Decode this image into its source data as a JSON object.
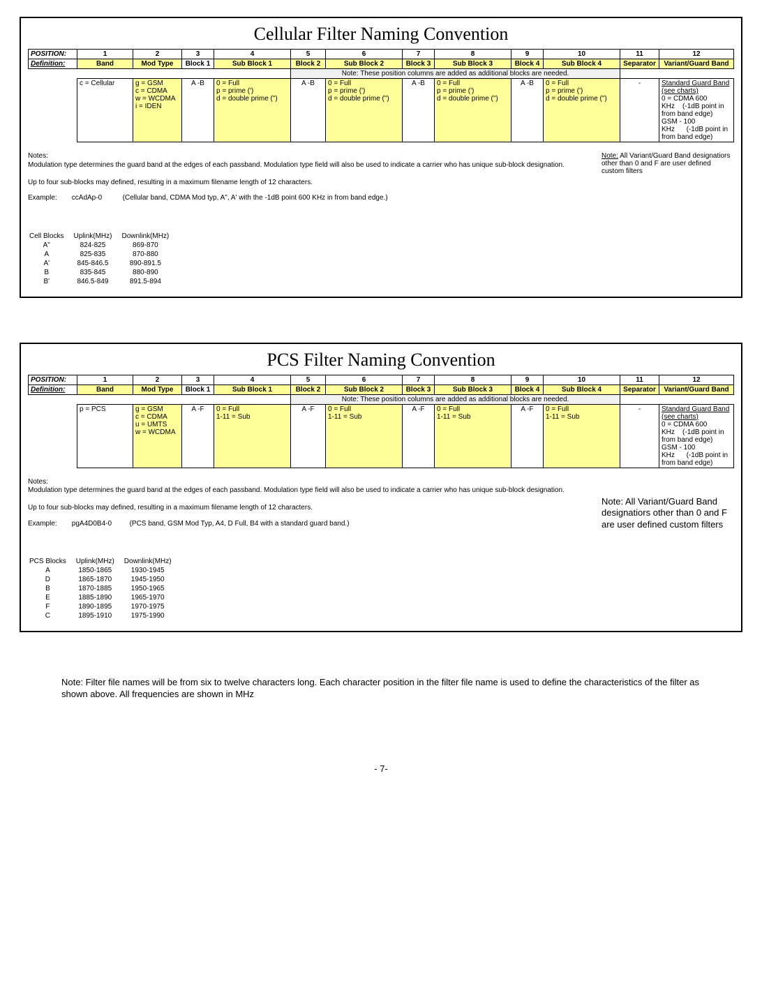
{
  "cellular": {
    "title": "Cellular Filter Naming Convention",
    "header_pos": "POSITION:",
    "header_def": "Definition:",
    "positions": [
      "1",
      "2",
      "3",
      "4",
      "5",
      "6",
      "7",
      "8",
      "9",
      "10",
      "11",
      "12"
    ],
    "defs": [
      "Band",
      "Mod Type",
      "Block 1",
      "Sub Block 1",
      "Block 2",
      "Sub Block 2",
      "Block 3",
      "Sub Block 3",
      "Block 4",
      "Sub Block 4",
      "Separator",
      "Variant/Guard Band"
    ],
    "row_note": "Note: These position columns are added as additional blocks are needed.",
    "band_val": "c = Cellular",
    "mod_vals": [
      "g = GSM",
      "c = CDMA",
      "w = WCDMA",
      "i = IDEN"
    ],
    "blk_range": "A -B",
    "sub_vals": [
      "0 = Full",
      "p = prime (')",
      "d = double prime (\")"
    ],
    "sep_val": "-",
    "guard_title": "Standard Guard Band (see charts)",
    "guard_l1a": "0 = CDMA 600 KHz",
    "guard_l1b": "(-1dB point in from band edge)",
    "guard_l2a": "GSM - 100 KHz",
    "guard_l2b": "(-1dB point in from band edge)",
    "notes_label": "Notes:",
    "notes_p1": "Modulation type determines the guard band at the edges of each passband.  Modulation type field will also be used to indicate a carrier who has unique sub-block designation.",
    "notes_p2": "Up to four sub-blocks may defined, resulting in a maximum filename length of 12 characters.",
    "ex_label": "Example:",
    "ex_code": "ccAdAp-0",
    "ex_desc": "(Cellular band, CDMA Mod typ, A\", A' with the -1dB point 600 KHz in from band edge.)",
    "side_note_lead": "Note:",
    "side_note": " All Variant/Guard Band designatiors other than 0 and F are user defined custom filters",
    "blocks_title": "Cell Blocks",
    "blocks_hdr_up": "Uplink(MHz)",
    "blocks_hdr_dn": "Downlink(MHz)",
    "blocks": [
      {
        "n": "A\"",
        "u": "824-825",
        "d": "869-870"
      },
      {
        "n": "A",
        "u": "825-835",
        "d": "870-880"
      },
      {
        "n": "A'",
        "u": "845-846.5",
        "d": "890-891.5"
      },
      {
        "n": "B",
        "u": "835-845",
        "d": "880-890"
      },
      {
        "n": "B'",
        "u": "846.5-849",
        "d": "891.5-894"
      }
    ]
  },
  "pcs": {
    "title": "PCS Filter Naming Convention",
    "header_pos": "POSITION:",
    "header_def": "Definition:",
    "positions": [
      "1",
      "2",
      "3",
      "4",
      "5",
      "6",
      "7",
      "8",
      "9",
      "10",
      "11",
      "12"
    ],
    "defs": [
      "Band",
      "Mod Type",
      "Block 1",
      "Sub Block 1",
      "Block 2",
      "Sub Block 2",
      "Block 3",
      "Sub Block 3",
      "Block 4",
      "Sub Block 4",
      "Separator",
      "Variant/Guard Band"
    ],
    "row_note": "Note: These position columns are added as additional blocks are needed.",
    "band_val": "p = PCS",
    "mod_vals": [
      "g = GSM",
      "c = CDMA",
      "u = UMTS",
      "w = WCDMA"
    ],
    "blk_range": "A -F",
    "sub_vals": [
      "0 = Full",
      "1-11 = Sub"
    ],
    "sep_val": "-",
    "guard_title": "Standard Guard Band (see charts)",
    "guard_l1a": "0 = CDMA 600 KHz",
    "guard_l1b": "(-1dB point in from band edge)",
    "guard_l2a": "GSM - 100 KHz",
    "guard_l2b": "(-1dB point in from band edge)",
    "notes_label": "Notes:",
    "notes_p1": "Modulation type determines the guard band at the edges of each passband.  Modulation type field will also be used to indicate a carrier who has unique sub-block designation.",
    "notes_p2": "Up to four sub-blocks may defined, resulting in a maximum filename length of 12 characters.",
    "ex_label": "Example:",
    "ex_code": "pgA4D0B4-0",
    "ex_desc": "(PCS band, GSM Mod Typ, A4, D Full, B4 with a standard guard band.)",
    "side_note": "Note: All Variant/Guard Band designatiors other than 0 and F are user defined custom filters",
    "blocks_title": "PCS Blocks",
    "blocks_hdr_up": "Uplink(MHz)",
    "blocks_hdr_dn": "Downlink(MHz)",
    "blocks": [
      {
        "n": "A",
        "u": "1850-1865",
        "d": "1930-1945"
      },
      {
        "n": "D",
        "u": "1865-1870",
        "d": "1945-1950"
      },
      {
        "n": "B",
        "u": "1870-1885",
        "d": "1950-1965"
      },
      {
        "n": "E",
        "u": "1885-1890",
        "d": "1965-1970"
      },
      {
        "n": "F",
        "u": "1890-1895",
        "d": "1970-1975"
      },
      {
        "n": "C",
        "u": "1895-1910",
        "d": "1975-1990"
      }
    ]
  },
  "footnote": "Note: Filter file names will be from six to twelve characters long. Each character position in the filter file name is used to define the characteristics of the filter as shown above. All frequencies are shown in MHz",
  "page_number": "- 7-"
}
